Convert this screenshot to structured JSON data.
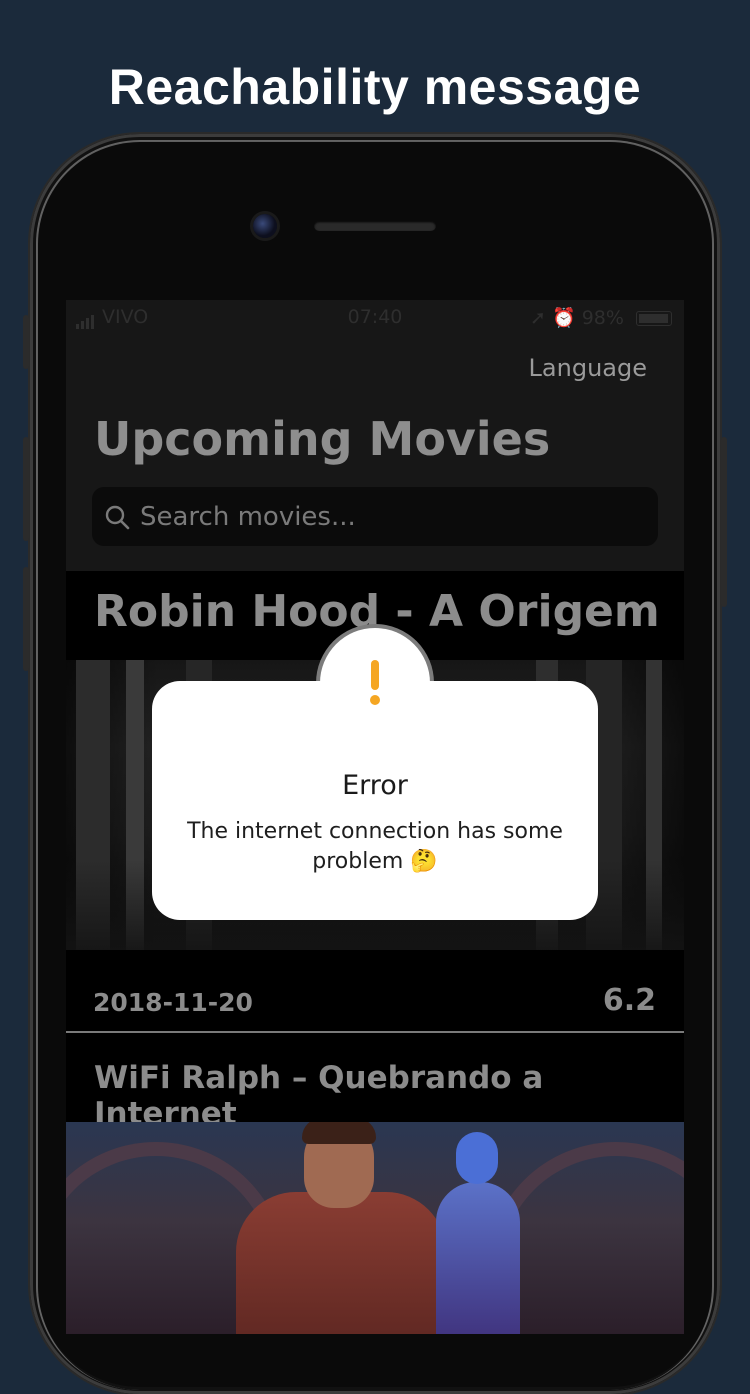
{
  "headline": "Reachability message",
  "status_bar": {
    "carrier": "VIVO",
    "time": "07:40",
    "battery": "98%"
  },
  "nav": {
    "language_label": "Language",
    "title": "Upcoming Movies"
  },
  "search": {
    "placeholder": "Search movies..."
  },
  "movies": [
    {
      "title": "Robin Hood - A Origem",
      "release_date": "2018-11-20",
      "rating": "6.2"
    },
    {
      "title": "WiFi Ralph – Quebrando a Internet"
    }
  ],
  "alert": {
    "icon": "exclamation-icon",
    "title": "Error",
    "message": "The internet connection has some problem 🤔",
    "accent_color": "#f5a623"
  },
  "colors": {
    "background": "#1b2a3b",
    "screen_text": "#8c8c8c"
  }
}
